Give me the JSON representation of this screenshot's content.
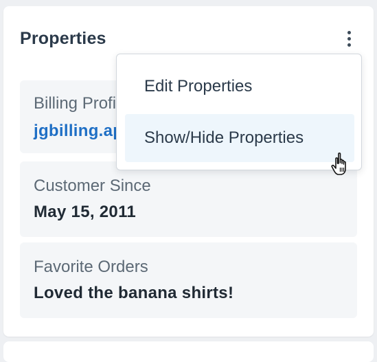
{
  "panel": {
    "title": "Properties",
    "menu_icon": "kebab-vertical-icon"
  },
  "properties": [
    {
      "label": "Billing Profile",
      "value": "jgbilling.app"
    },
    {
      "label": "Customer Since",
      "value": "May 15, 2011"
    },
    {
      "label": "Favorite Orders",
      "value": "Loved the banana shirts!"
    }
  ],
  "menu": {
    "items": [
      {
        "label": "Edit Properties"
      },
      {
        "label": "Show/Hide Properties"
      }
    ]
  },
  "cursor": "pointer-hand-icon",
  "colors": {
    "link": "#1f6fc5",
    "title": "#2b3a4a",
    "hover": "#eef6fc"
  }
}
